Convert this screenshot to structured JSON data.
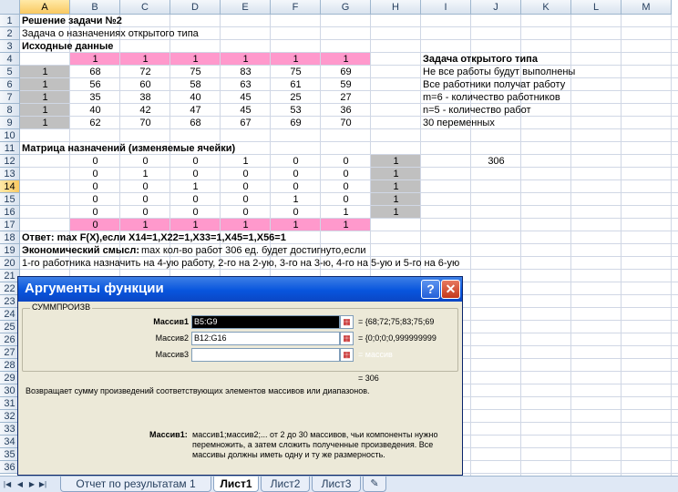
{
  "columns": [
    "A",
    "B",
    "C",
    "D",
    "E",
    "F",
    "G",
    "H",
    "I",
    "J",
    "K",
    "L",
    "M"
  ],
  "rows": [
    "1",
    "2",
    "3",
    "4",
    "5",
    "6",
    "7",
    "8",
    "9",
    "10",
    "11",
    "12",
    "13",
    "14",
    "15",
    "16",
    "17",
    "18",
    "19",
    "20",
    "21",
    "22",
    "23",
    "24",
    "25",
    "26",
    "27",
    "28",
    "29",
    "30",
    "31",
    "32",
    "33",
    "34",
    "35",
    "36"
  ],
  "selected_column": "A",
  "selected_row": "14",
  "colors": {
    "pink": "#ff99cc",
    "gray": "#c0c0c0",
    "dialog_title": "#0855dd",
    "grid": "#d0d7e5"
  },
  "cells": {
    "r1": "Решение задачи №2",
    "r2": "Задача о назначениях открытого типа",
    "r3": "Исходные данные",
    "r4": [
      "1",
      "1",
      "1",
      "1",
      "1",
      "1"
    ],
    "costs": [
      {
        "a": "1",
        "v": [
          "68",
          "72",
          "75",
          "83",
          "75",
          "69"
        ]
      },
      {
        "a": "1",
        "v": [
          "56",
          "60",
          "58",
          "63",
          "61",
          "59"
        ]
      },
      {
        "a": "1",
        "v": [
          "35",
          "38",
          "40",
          "45",
          "25",
          "27"
        ]
      },
      {
        "a": "1",
        "v": [
          "40",
          "42",
          "47",
          "45",
          "53",
          "36"
        ]
      },
      {
        "a": "1",
        "v": [
          "62",
          "70",
          "68",
          "67",
          "69",
          "70"
        ]
      }
    ],
    "side_title": "Задача открытого типа",
    "side_notes": [
      "Не все работы будут выполнены",
      "Все работники получат работу",
      "m=6 - количество работников",
      "n=5 - количество работ",
      "30 переменных"
    ],
    "r11": "Матрица назначений (изменяемые ячейки)",
    "assign": [
      {
        "v": [
          "0",
          "0",
          "0",
          "1",
          "0",
          "0"
        ],
        "h": "1"
      },
      {
        "v": [
          "0",
          "1",
          "0",
          "0",
          "0",
          "0"
        ],
        "h": "1"
      },
      {
        "v": [
          "0",
          "0",
          "1",
          "0",
          "0",
          "0"
        ],
        "h": "1"
      },
      {
        "v": [
          "0",
          "0",
          "0",
          "0",
          "1",
          "0"
        ],
        "h": "1"
      },
      {
        "v": [
          "0",
          "0",
          "0",
          "0",
          "0",
          "1"
        ],
        "h": "1"
      }
    ],
    "j12": "306",
    "r17": [
      "0",
      "1",
      "1",
      "1",
      "1",
      "1"
    ],
    "r18": "Ответ: max F(X),если X14=1,X22=1,X33=1,X45=1,X56=1",
    "r19_bold": "Экономический смысл:",
    "r19_rest": "max кол-во работ 306 ед. будет достигнуто,если",
    "r20": "1-го работника назначить на 4-ую работу, 2-го на 2-ую, 3-го на 3-ю, 4-го на 5-ую и 5-го на 6-ую"
  },
  "dialog": {
    "title": "Аргументы функции",
    "help": "?",
    "close": "✕",
    "function_name": "СУММПРОИЗВ",
    "args": [
      {
        "label": "Массив1",
        "value": "B5:G9",
        "result": "= {68;72;75;83;75;69"
      },
      {
        "label": "Массив2",
        "value": "B12:G16",
        "result": "= {0;0;0;0,999999999"
      },
      {
        "label": "Массив3",
        "value": "",
        "result": "= массив"
      }
    ],
    "total": "= 306",
    "description": "Возвращает сумму произведений соответствующих элементов массивов или диапазонов.",
    "arg_help_label": "Массив1:",
    "arg_help_text": [
      "массив1;массив2;... от 2 до 30 массивов, чьи компоненты нужно",
      "перемножить, а затем сложить полученные произведения. Все",
      "массивы должны иметь одну и ту же размерность."
    ]
  },
  "tabs": [
    "Отчет по результатам 1",
    "Лист1",
    "Лист2",
    "Лист3"
  ],
  "active_tab": "Лист1",
  "nav_icons": [
    "first-sheet-icon",
    "prev-sheet-icon",
    "next-sheet-icon",
    "last-sheet-icon"
  ]
}
